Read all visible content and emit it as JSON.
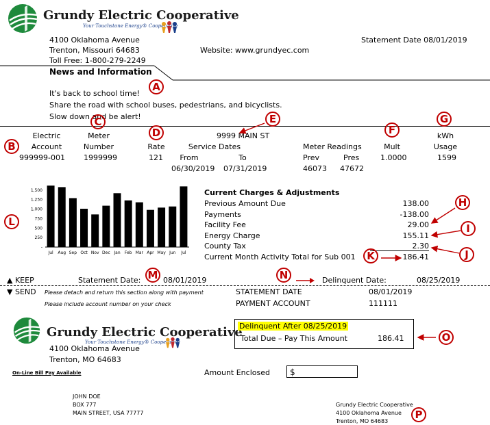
{
  "company": {
    "name": "Grundy Electric Cooperative",
    "tagline": "Your Touchstone Energy® Cooperative",
    "address1": "4100 Oklahoma Avenue",
    "address2": "Trenton,  Missouri 64683",
    "tollfree": "Toll Free:  1-800-279-2249",
    "website": "Website:  www.grundyec.com",
    "statement_date": "Statement  Date 08/01/2019"
  },
  "news": {
    "title": "News and Information",
    "line1": "It's back to school time!",
    "line2": "Share the road with school buses, pedestrians, and bicyclists.",
    "line3": "Slow down and be alert!"
  },
  "service": {
    "address": "9999 MAIN ST",
    "h_electric": "Electric",
    "h_account": "Account",
    "h_meter": "Meter",
    "h_number": "Number",
    "h_rate": "Rate",
    "h_service_dates": "Service Dates",
    "h_from": "From",
    "h_to": "To",
    "h_meter_readings": "Meter  Readings",
    "h_prev": "Prev",
    "h_pres": "Pres",
    "h_mult": "Mult",
    "h_kwh": "kWh",
    "h_usage": "Usage",
    "account": "999999-001",
    "meter": "1999999",
    "rate": "121",
    "from": "06/30/2019",
    "to": "07/31/2019",
    "prev": "46073",
    "pres": "47672",
    "mult": "1.0000",
    "usage": "1599"
  },
  "chart_data": {
    "type": "bar",
    "categories": [
      "Jul",
      "Aug",
      "Sep",
      "Oct",
      "Nov",
      "Dec",
      "Jan",
      "Feb",
      "Mar",
      "Apr",
      "May",
      "Jun",
      "Jul"
    ],
    "values": [
      1620,
      1580,
      1290,
      1010,
      860,
      1090,
      1420,
      1230,
      1180,
      980,
      1040,
      1070,
      1599
    ],
    "yticks": [
      "1,500",
      "1,250",
      "1,000",
      "750",
      "500",
      "250",
      "-"
    ],
    "ylim": [
      0,
      1750
    ],
    "grid": false
  },
  "charges": {
    "title": "Current Charges & Adjustments",
    "rows": [
      {
        "label": "Previous Amount Due",
        "value": "138.00"
      },
      {
        "label": "Payments",
        "value": "-138.00"
      },
      {
        "label": "Facility Fee",
        "value": "29.00"
      },
      {
        "label": "Energy Charge",
        "value": "155.11"
      },
      {
        "label": "County Tax",
        "value": "2.30"
      },
      {
        "label": "Current Month Activity Total for Sub 001",
        "value": "186.41"
      }
    ]
  },
  "stub": {
    "keep": "▲ KEEP",
    "send": "▼ SEND",
    "statement_date_label": "Statement Date:",
    "statement_date": "08/01/2019",
    "delinquent_label": "Delinquent  Date:",
    "delinquent_date": "08/25/2019",
    "detach_note": "Please detach and return this section along with payment",
    "include_note": "Please include account number on your check",
    "statement_date_caps": "STATEMENT DATE",
    "statement_date_caps_value": "08/01/2019",
    "payment_account": "PAYMENT ACCOUNT",
    "payment_account_value": "111111",
    "address1": "4100 Oklahoma Avenue",
    "address2": "Trenton, MO 64683",
    "online_pay": "On-Line Bill Pay Available",
    "delinquent_after": "Delinquent After  08/25/2019",
    "total_due_label": "Total Due – Pay This Amount",
    "total_due": "186.41",
    "amount_enclosed": "Amount Enclosed",
    "dollar": "$",
    "customer": [
      "JOHN DOE",
      "BOX 777",
      "MAIN STREET,  USA 77777"
    ],
    "remit": [
      "Grundy Electric Cooperative",
      "4100 Oklahoma Avenue",
      "Trenton,  MO 64683"
    ]
  },
  "callouts": [
    "A",
    "B",
    "C",
    "D",
    "E",
    "F",
    "G",
    "H",
    "I",
    "J",
    "K",
    "L",
    "M",
    "N",
    "O",
    "P"
  ],
  "colors": {
    "callout": "#c00000",
    "highlight": "#ffff00",
    "logo_green": "#1e8a3c"
  }
}
